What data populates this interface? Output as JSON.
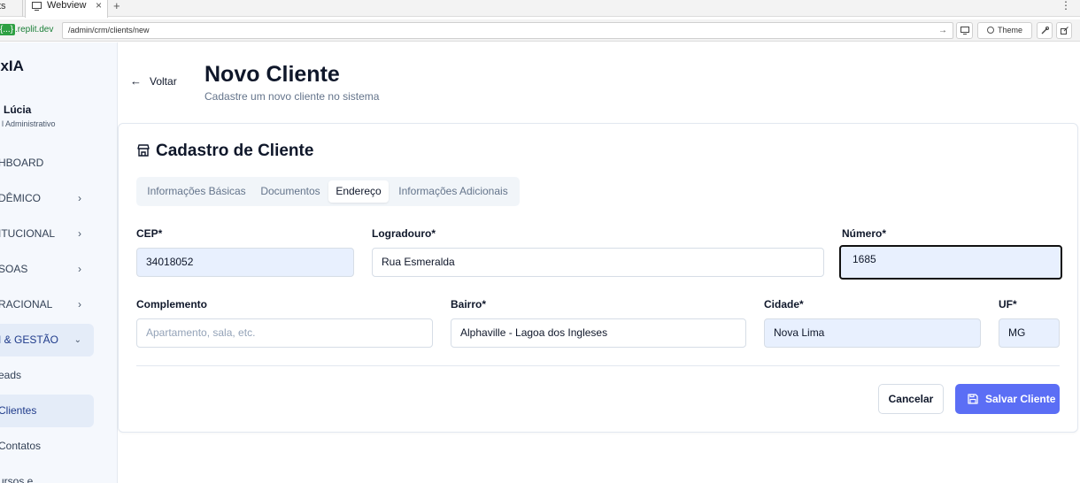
{
  "browser": {
    "prev_tab_label": "ts",
    "active_tab_label": "Webview",
    "close_glyph": "×",
    "new_tab_glyph": "+",
    "menu_glyph": "⋮",
    "domain_prefix": "{...}",
    "domain_suffix": ".replit.dev",
    "url": "/admin/crm/clients/new",
    "go_glyph": "→",
    "theme_label": "Theme"
  },
  "sidebar": {
    "brand": "exIA",
    "user_name": "Lúcia",
    "user_role": "l Administrativo",
    "items": [
      {
        "label": "HBOARD",
        "has_chevron": false
      },
      {
        "label": "DÊMICO",
        "has_chevron": true
      },
      {
        "label": "ITUCIONAL",
        "has_chevron": true
      },
      {
        "label": "SOAS",
        "has_chevron": true
      },
      {
        "label": "RACIONAL",
        "has_chevron": true
      },
      {
        "label": "I & GESTÃO",
        "has_chevron": true,
        "expanded": true
      },
      {
        "label": "eads"
      },
      {
        "label": "Clientes",
        "active": true
      },
      {
        "label": "Contatos"
      },
      {
        "label": "ursos e"
      }
    ]
  },
  "header": {
    "back_label": "Voltar",
    "title": "Novo Cliente",
    "subtitle": "Cadastre um novo cliente no sistema"
  },
  "card": {
    "title": "Cadastro de Cliente",
    "tabs": [
      {
        "label": "Informações Básicas",
        "active": false
      },
      {
        "label": "Documentos",
        "active": false
      },
      {
        "label": "Endereço",
        "active": true
      },
      {
        "label": "Informações Adicionais",
        "active": false
      }
    ]
  },
  "form": {
    "cep": {
      "label": "CEP*",
      "value": "34018052"
    },
    "logradouro": {
      "label": "Logradouro*",
      "value": "Rua Esmeralda"
    },
    "numero": {
      "label": "Número*",
      "value": "1685"
    },
    "complemento": {
      "label": "Complemento",
      "value": "",
      "placeholder": "Apartamento, sala, etc."
    },
    "bairro": {
      "label": "Bairro*",
      "value": "Alphaville - Lagoa dos Ingleses"
    },
    "cidade": {
      "label": "Cidade*",
      "value": "Nova Lima"
    },
    "uf": {
      "label": "UF*",
      "value": "MG"
    }
  },
  "actions": {
    "cancel_label": "Cancelar",
    "save_label": "Salvar Cliente"
  },
  "colors": {
    "primary": "#5b6ef5",
    "autofill": "#e8f0fe",
    "sidebar_bg": "#f5f8fd"
  }
}
